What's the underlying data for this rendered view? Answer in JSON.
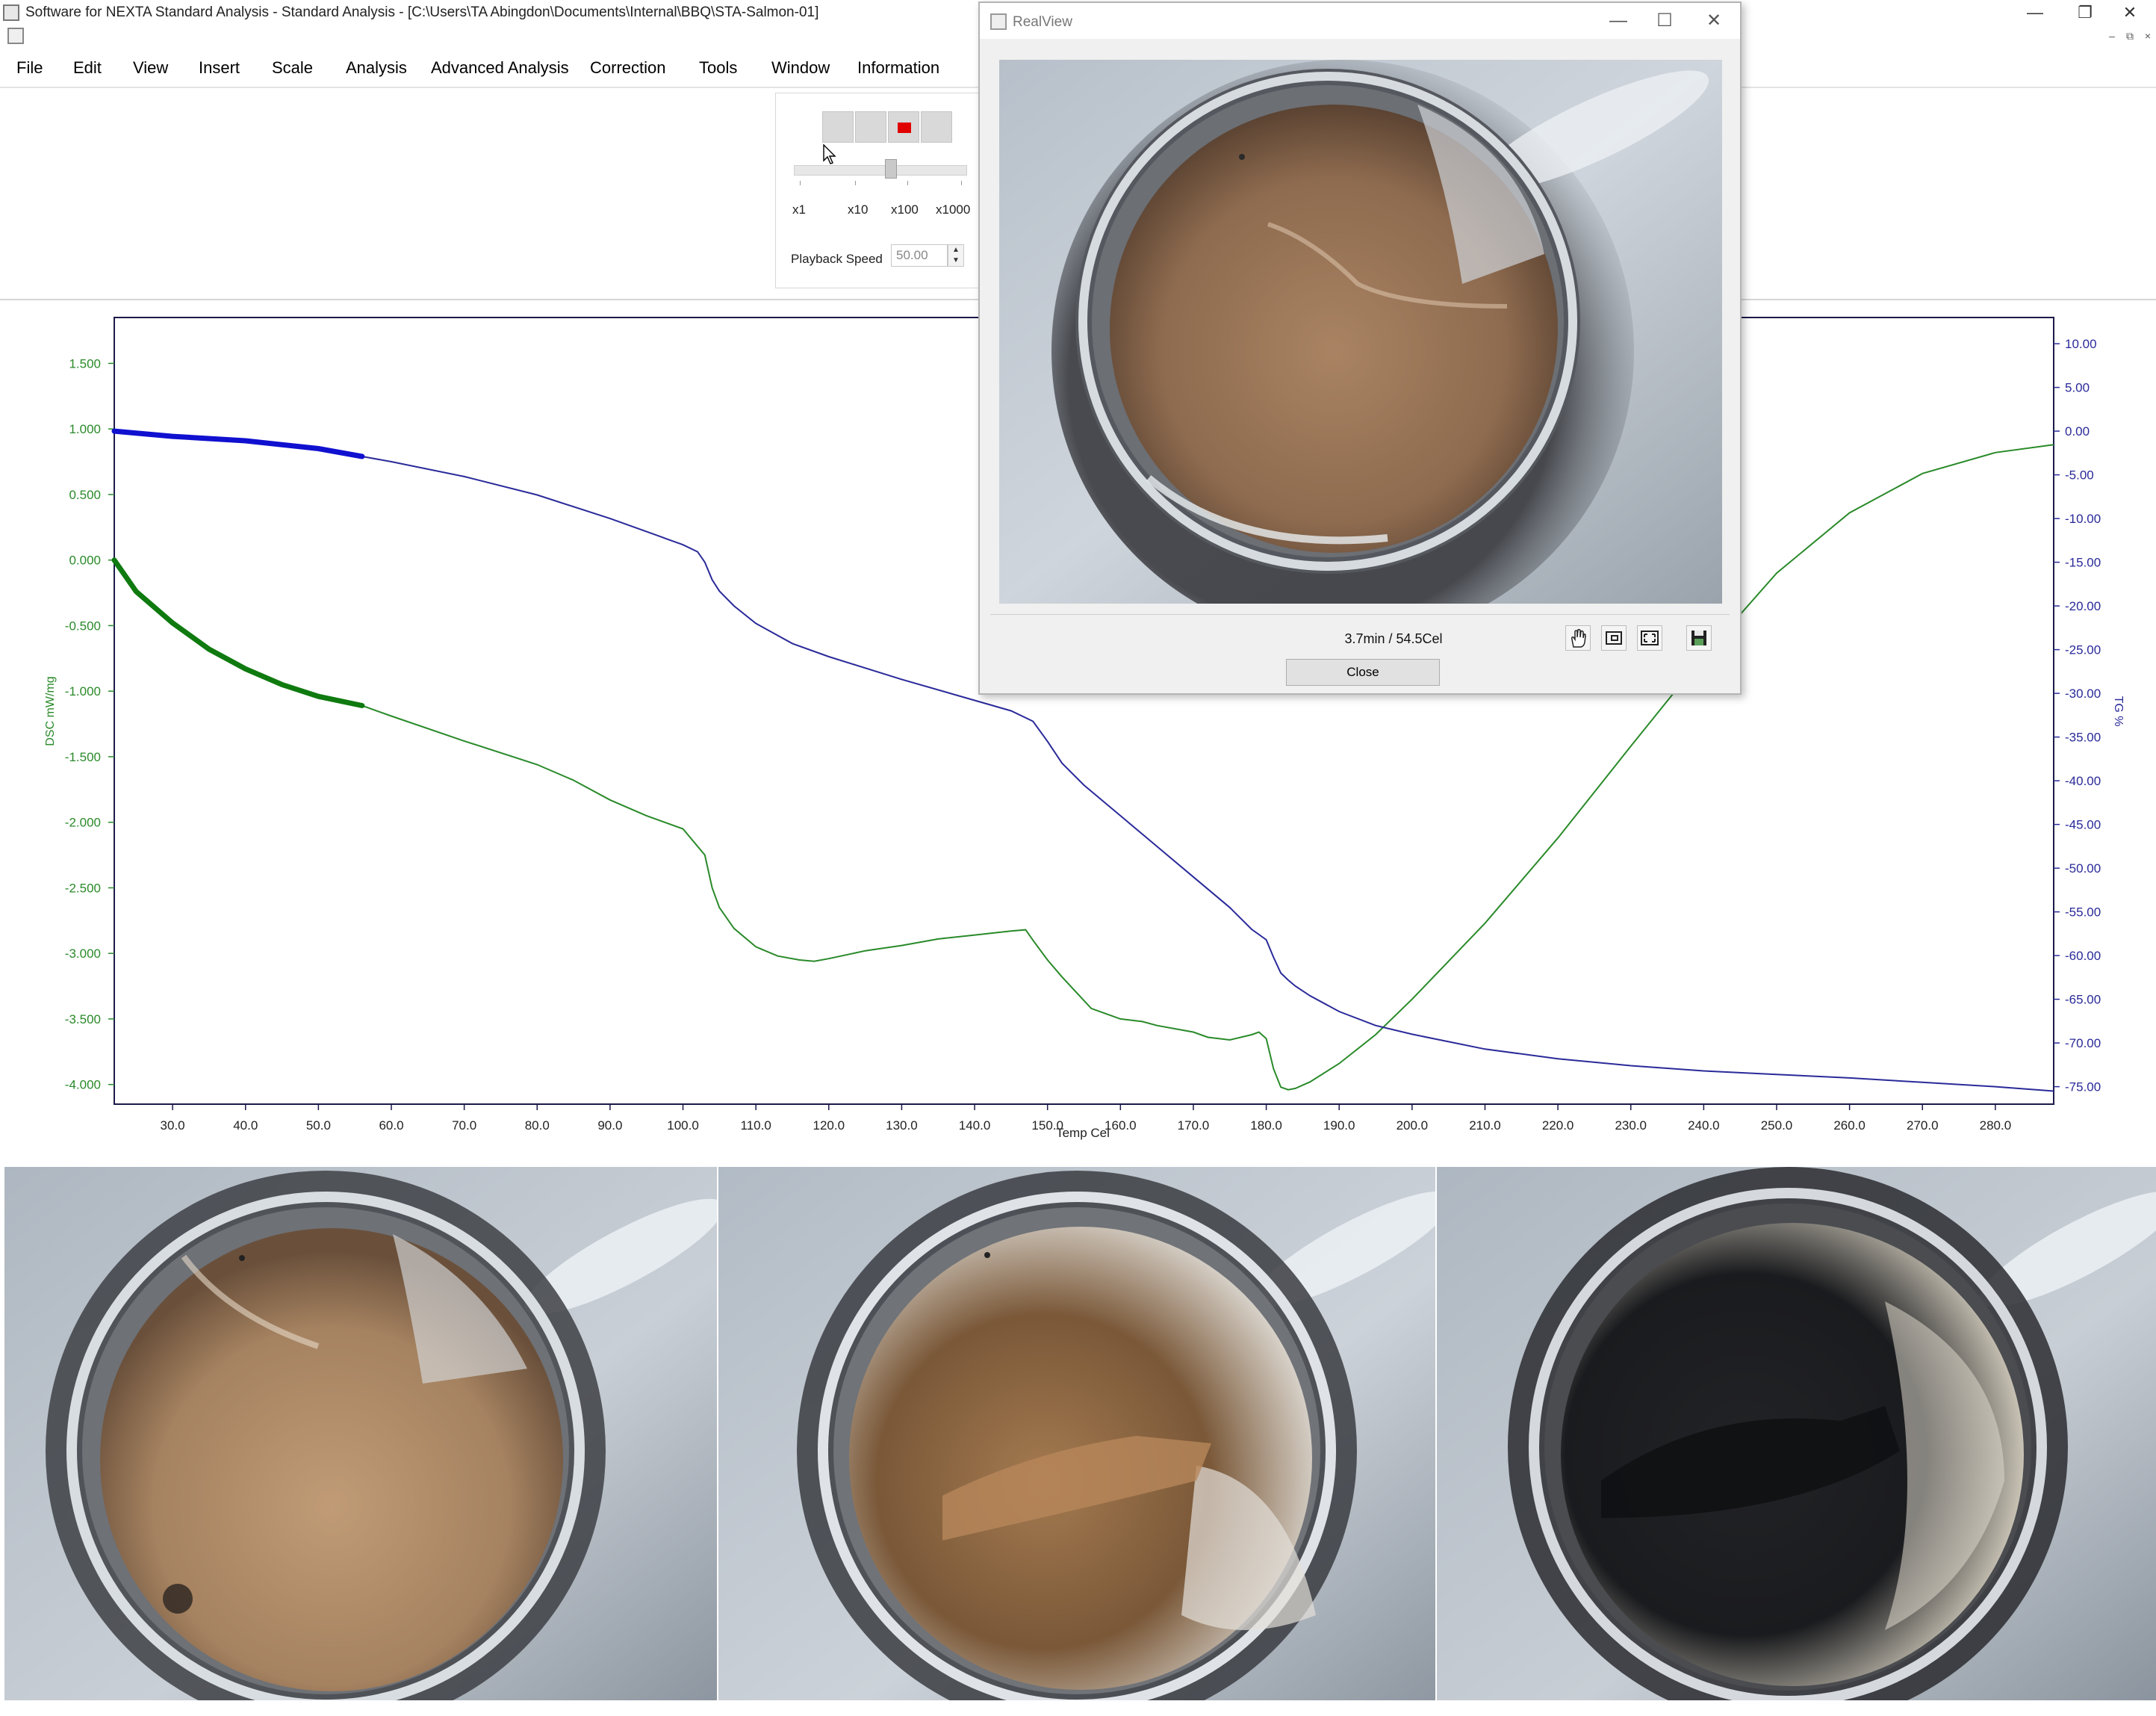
{
  "window": {
    "title": "Software for NEXTA Standard Analysis - Standard Analysis - [C:\\Users\\TA Abingdon\\Documents\\Internal\\BBQ\\STA-Salmon-01]",
    "minimize_glyph": "—",
    "restore_glyph": "❐",
    "close_glyph": "✕",
    "mdi_minimize": "–",
    "mdi_restore": "⧉",
    "mdi_close": "×"
  },
  "menu": [
    "File",
    "Edit",
    "View",
    "Insert",
    "Scale",
    "Analysis",
    "Advanced Analysis",
    "Correction",
    "Tools",
    "Window",
    "Information"
  ],
  "playback": {
    "scales": [
      "x1",
      "x10",
      "x100",
      "x1000"
    ],
    "speed_label": "Playback Speed",
    "speed_value": "50.00",
    "spin_up": "▲",
    "spin_down": "▼",
    "record_color": "#e00000"
  },
  "realview": {
    "title": "RealView",
    "minimize_glyph": "—",
    "maximize_glyph": "☐",
    "close_glyph": "✕",
    "status": "3.7min / 54.5Cel",
    "close_label": "Close",
    "tool_icons": [
      "hand-icon",
      "frame-icon",
      "fit-screen-icon",
      "save-icon"
    ]
  },
  "chart_data": {
    "type": "line",
    "xlabel": "Temp Cel",
    "ylabel_left": "DSC mW/mg",
    "ylabel_right": "TG %",
    "xlim": [
      22,
      288
    ],
    "ylim_left": [
      -4.15,
      1.85
    ],
    "ylim_right": [
      -77,
      13
    ],
    "x_ticks": [
      "30.0",
      "40.0",
      "50.0",
      "60.0",
      "70.0",
      "80.0",
      "90.0",
      "100.0",
      "110.0",
      "120.0",
      "130.0",
      "140.0",
      "150.0",
      "160.0",
      "170.0",
      "180.0",
      "190.0",
      "200.0",
      "210.0",
      "220.0",
      "230.0",
      "240.0",
      "250.0",
      "260.0",
      "270.0",
      "280.0"
    ],
    "y_ticks_left": [
      "1.500",
      "1.000",
      "0.500",
      "0.000",
      "-0.500",
      "-1.000",
      "-1.500",
      "-2.000",
      "-2.500",
      "-3.000",
      "-3.500",
      "-4.000"
    ],
    "y_ticks_right": [
      "10.00",
      "5.00",
      "0.00",
      "-5.00",
      "-10.00",
      "-15.00",
      "-20.00",
      "-25.00",
      "-30.00",
      "-35.00",
      "-40.00",
      "-45.00",
      "-50.00",
      "-55.00",
      "-60.00",
      "-65.00",
      "-70.00",
      "-75.00"
    ],
    "highlight_until_x": 56,
    "series": [
      {
        "axis": "left",
        "color": "#2a8a2a",
        "highlight_color": "#0f7a0f",
        "x": [
          22,
          25,
          30,
          35,
          40,
          45,
          50,
          56,
          60,
          70,
          80,
          85,
          90,
          95,
          100,
          103,
          104,
          105,
          107,
          110,
          113,
          116,
          118,
          120,
          125,
          130,
          133,
          135,
          140,
          145,
          147,
          148,
          150,
          152,
          154,
          156,
          158,
          160,
          163,
          165,
          168,
          170,
          172,
          175,
          178,
          179,
          180,
          181,
          182,
          183,
          184,
          186,
          190,
          195,
          200,
          210,
          220,
          230,
          240,
          250,
          260,
          270,
          280,
          288
        ],
        "y": [
          0.0,
          -0.24,
          -0.48,
          -0.68,
          -0.83,
          -0.95,
          -1.04,
          -1.11,
          -1.19,
          -1.38,
          -1.56,
          -1.68,
          -1.83,
          -1.95,
          -2.05,
          -2.25,
          -2.5,
          -2.65,
          -2.81,
          -2.95,
          -3.02,
          -3.05,
          -3.06,
          -3.04,
          -2.98,
          -2.94,
          -2.91,
          -2.89,
          -2.86,
          -2.83,
          -2.82,
          -2.9,
          -3.05,
          -3.18,
          -3.3,
          -3.42,
          -3.46,
          -3.5,
          -3.52,
          -3.55,
          -3.58,
          -3.6,
          -3.64,
          -3.66,
          -3.62,
          -3.6,
          -3.65,
          -3.88,
          -4.02,
          -4.04,
          -4.03,
          -3.98,
          -3.84,
          -3.62,
          -3.35,
          -2.77,
          -2.12,
          -1.42,
          -0.73,
          -0.1,
          0.36,
          0.66,
          0.82,
          0.88
        ]
      },
      {
        "axis": "right",
        "color": "#2a2a9a",
        "highlight_color": "#1010d0",
        "x": [
          22,
          30,
          40,
          50,
          56,
          60,
          70,
          80,
          90,
          95,
          100,
          102,
          103,
          104,
          105,
          107,
          110,
          115,
          120,
          130,
          140,
          145,
          148,
          150,
          152,
          155,
          160,
          165,
          170,
          175,
          178,
          180,
          181,
          182,
          183,
          184,
          186,
          190,
          195,
          200,
          210,
          220,
          230,
          240,
          250,
          260,
          270,
          280,
          288
        ],
        "y": [
          0.0,
          -0.6,
          -1.1,
          -2.0,
          -2.9,
          -3.5,
          -5.2,
          -7.3,
          -10.0,
          -11.5,
          -13.0,
          -13.8,
          -15.0,
          -17.0,
          -18.3,
          -20.0,
          -22.0,
          -24.3,
          -25.8,
          -28.4,
          -30.8,
          -32.0,
          -33.2,
          -35.5,
          -38.0,
          -40.5,
          -44.0,
          -47.5,
          -51.0,
          -54.5,
          -57.0,
          -58.2,
          -60.2,
          -62.0,
          -62.8,
          -63.5,
          -64.6,
          -66.4,
          -68.0,
          -69.0,
          -70.7,
          -71.8,
          -72.6,
          -73.2,
          -73.6,
          -74.0,
          -74.5,
          -75.0,
          -75.5
        ]
      }
    ]
  }
}
